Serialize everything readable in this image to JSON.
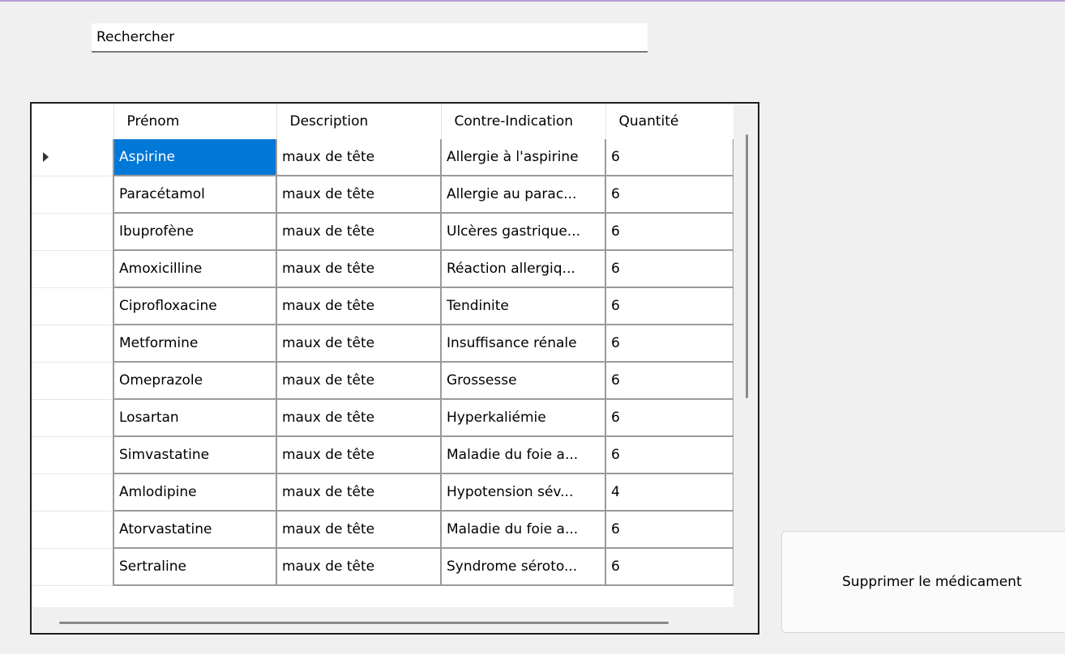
{
  "search": {
    "value": "Rechercher"
  },
  "grid": {
    "columns": [
      "Prénom",
      "Description",
      "Contre-Indication",
      "Quantité"
    ],
    "selected_row": 0,
    "rows": [
      {
        "name": "Aspirine",
        "description": "maux de tête",
        "contraindication": "Allergie à l'aspirine",
        "quantity": "6"
      },
      {
        "name": "Paracétamol",
        "description": "maux de tête",
        "contraindication": "Allergie au parac...",
        "quantity": "6"
      },
      {
        "name": "Ibuprofène",
        "description": "maux de tête",
        "contraindication": "Ulcères gastrique...",
        "quantity": "6"
      },
      {
        "name": "Amoxicilline",
        "description": "maux de tête",
        "contraindication": "Réaction allergiq...",
        "quantity": "6"
      },
      {
        "name": "Ciprofloxacine",
        "description": "maux de tête",
        "contraindication": "Tendinite",
        "quantity": "6"
      },
      {
        "name": "Metformine",
        "description": "maux de tête",
        "contraindication": "Insuffisance rénale",
        "quantity": "6"
      },
      {
        "name": "Omeprazole",
        "description": "maux de tête",
        "contraindication": "Grossesse",
        "quantity": "6"
      },
      {
        "name": "Losartan",
        "description": "maux de tête",
        "contraindication": "Hyperkaliémie",
        "quantity": "6"
      },
      {
        "name": "Simvastatine",
        "description": "maux de tête",
        "contraindication": "Maladie du foie a...",
        "quantity": "6"
      },
      {
        "name": "Amlodipine",
        "description": "maux de tête",
        "contraindication": "Hypotension sév...",
        "quantity": "4"
      },
      {
        "name": "Atorvastatine",
        "description": "maux de tête",
        "contraindication": "Maladie du foie a...",
        "quantity": "6"
      },
      {
        "name": "Sertraline",
        "description": "maux de tête",
        "contraindication": "Syndrome séroto...",
        "quantity": "6"
      }
    ]
  },
  "delete_button": {
    "label": "Supprimer le médicament"
  },
  "colors": {
    "selection": "#0078d7",
    "window_background": "#f0f0f0",
    "window_border": "#b79ad8"
  }
}
